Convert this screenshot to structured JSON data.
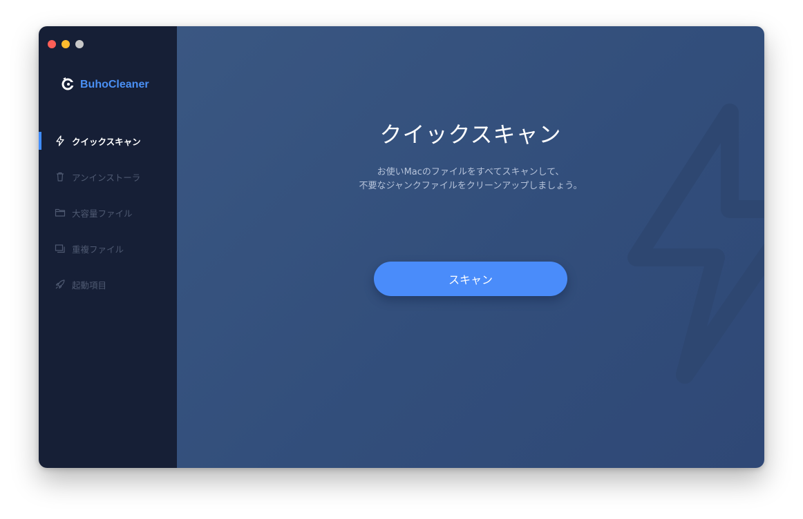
{
  "app": {
    "name": "BuhoCleaner"
  },
  "sidebar": {
    "items": [
      {
        "label": "クイックスキャン",
        "icon": "lightning-icon",
        "active": true
      },
      {
        "label": "アンインストーラ",
        "icon": "trash-icon",
        "active": false
      },
      {
        "label": "大容量ファイル",
        "icon": "folder-icon",
        "active": false
      },
      {
        "label": "重複ファイル",
        "icon": "duplicate-icon",
        "active": false
      },
      {
        "label": "起動項目",
        "icon": "rocket-icon",
        "active": false
      }
    ]
  },
  "main": {
    "title": "クイックスキャン",
    "description_line1": "お使いMacのファイルをすべてスキャンして、",
    "description_line2": "不要なジャンクファイルをクリーンアップしましょう。",
    "scan_button": "スキャン"
  },
  "colors": {
    "accent": "#4a8cfa",
    "sidebar_bg": "#161f36",
    "main_bg": "#354f7c"
  }
}
